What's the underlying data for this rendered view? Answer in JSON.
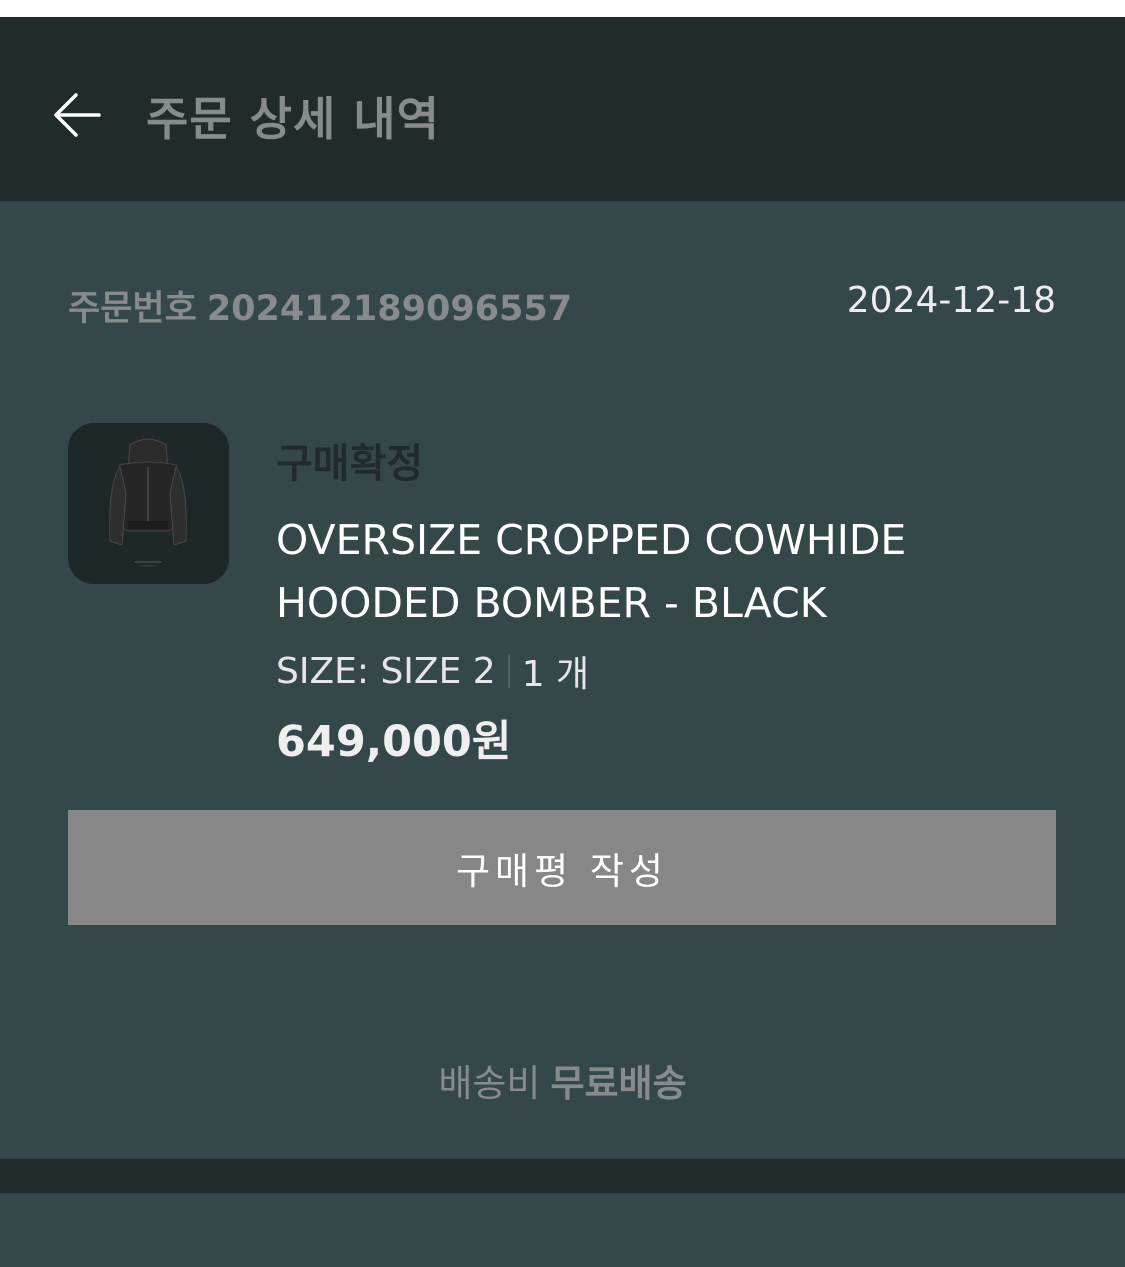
{
  "header": {
    "title": "주문 상세 내역",
    "back_icon": "arrow-left-icon"
  },
  "order": {
    "number_label": "주문번호",
    "number": "202412189096557",
    "date": "2024-12-18"
  },
  "product": {
    "status": "구매확정",
    "name": "OVERSIZE CROPPED COWHIDE HOODED BOMBER - BLACK",
    "option": "SIZE: SIZE 2",
    "quantity": "1 개",
    "price": "649,000원"
  },
  "actions": {
    "review_label": "구매평 작성"
  },
  "shipping": {
    "label": "배송비",
    "value": "무료배송"
  },
  "colors": {
    "header_bg": "#212b2b",
    "page_bg": "#34484a",
    "button_bg": "#878787"
  }
}
